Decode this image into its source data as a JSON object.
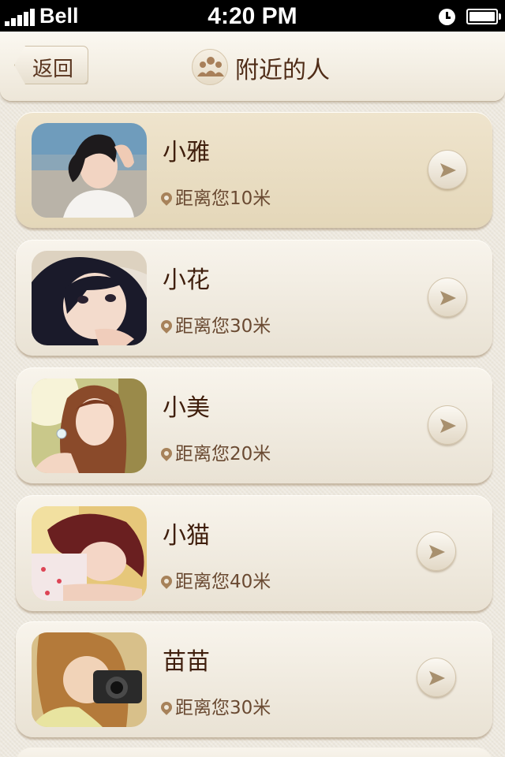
{
  "status_bar": {
    "carrier": "Bell",
    "time": "4:20 PM",
    "battery_level": 1.0
  },
  "nav": {
    "back_label": "返回",
    "title": "附近的人",
    "title_icon": "people-icon"
  },
  "people": [
    {
      "name": "小雅",
      "distance": "距离您10米",
      "highlighted": true
    },
    {
      "name": "小花",
      "distance": "距离您30米",
      "highlighted": false
    },
    {
      "name": "小美",
      "distance": "距离您20米",
      "highlighted": false
    },
    {
      "name": "小猫",
      "distance": "距离您40米",
      "highlighted": false
    },
    {
      "name": "苗苗",
      "distance": "距离您30米",
      "highlighted": false
    }
  ],
  "colors": {
    "background": "#ece7dc",
    "title_text": "#4f2c17",
    "accent_brown": "#a7825a",
    "highlight_card": "#e8dcc0"
  }
}
